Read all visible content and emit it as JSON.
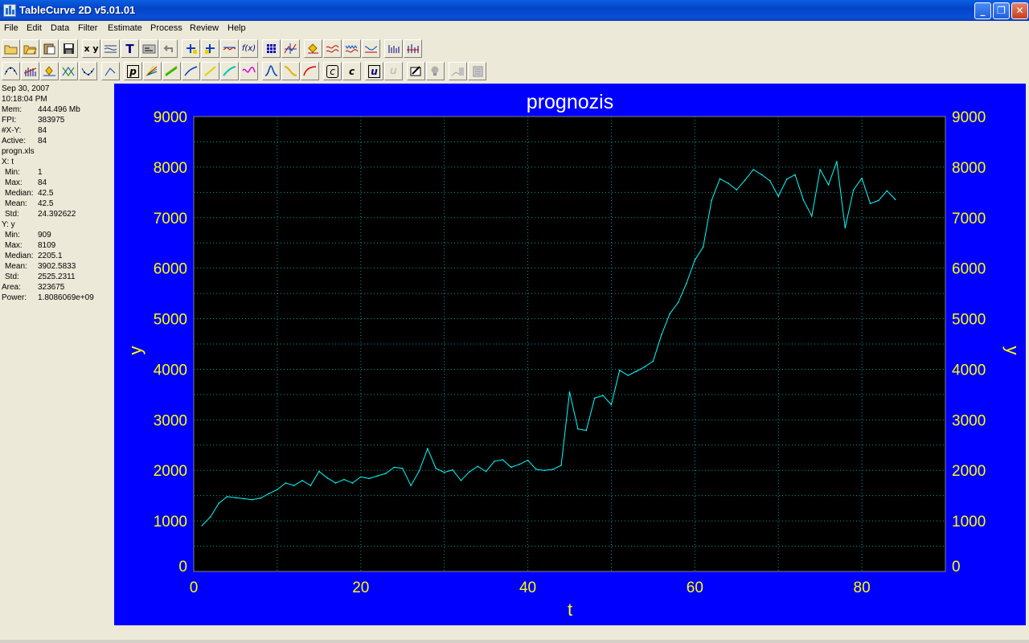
{
  "window": {
    "title": "TableCurve 2D v5.01.01"
  },
  "menu": [
    "File",
    "Edit",
    "Data",
    "Filter",
    "Estimate",
    "Process",
    "Review",
    "Help"
  ],
  "stats": {
    "date": "Sep 30, 2007",
    "time": "10:18:04 PM",
    "general": [
      {
        "key": "Mem:",
        "value": "444.496 Mb"
      },
      {
        "key": "FPI:",
        "value": "383975"
      },
      {
        "key": "#X-Y:",
        "value": "84"
      },
      {
        "key": "Active:",
        "value": "84"
      }
    ],
    "file": "progn.xls",
    "x_header": "X: t",
    "x_stats": [
      {
        "key": "Min:",
        "value": "1"
      },
      {
        "key": "Max:",
        "value": "84"
      },
      {
        "key": "Median:",
        "value": "42.5"
      },
      {
        "key": "Mean:",
        "value": "42.5"
      },
      {
        "key": "Std:",
        "value": "24.392622"
      }
    ],
    "y_header": "Y: y",
    "y_stats": [
      {
        "key": "Min:",
        "value": "909"
      },
      {
        "key": "Max:",
        "value": "8109"
      },
      {
        "key": "Median:",
        "value": "2205.1"
      },
      {
        "key": "Mean:",
        "value": "3902.5833"
      },
      {
        "key": "Std:",
        "value": "2525.2311"
      }
    ],
    "extra": [
      {
        "key": "Area:",
        "value": "323675"
      },
      {
        "key": "Power:",
        "value": "1.8086069e+09"
      }
    ]
  },
  "colors": {
    "panel_bg": "#0000ff",
    "plot_bg": "#000000",
    "axis_text": "#ffff00",
    "title_text": "#ffffff",
    "series": "#00ffff",
    "grid": "#00a0a0"
  },
  "chart_data": {
    "type": "line",
    "title": "prognozis",
    "xlabel": "t",
    "ylabel": "y",
    "xlim": [
      0,
      90
    ],
    "ylim": [
      0,
      9000
    ],
    "xticks": [
      0,
      20,
      40,
      60,
      80
    ],
    "yticks": [
      0,
      1000,
      2000,
      3000,
      4000,
      5000,
      6000,
      7000,
      8000,
      9000
    ],
    "grid": true,
    "x": [
      1,
      2,
      3,
      4,
      5,
      6,
      7,
      8,
      9,
      10,
      11,
      12,
      13,
      14,
      15,
      16,
      17,
      18,
      19,
      20,
      21,
      22,
      23,
      24,
      25,
      26,
      27,
      28,
      29,
      30,
      31,
      32,
      33,
      34,
      35,
      36,
      37,
      38,
      39,
      40,
      41,
      42,
      43,
      44,
      45,
      46,
      47,
      48,
      49,
      50,
      51,
      52,
      53,
      54,
      55,
      56,
      57,
      58,
      59,
      60,
      61,
      62,
      63,
      64,
      65,
      66,
      67,
      68,
      69,
      70,
      71,
      72,
      73,
      74,
      75,
      76,
      77,
      78,
      79,
      80,
      81,
      82,
      83,
      84
    ],
    "y": [
      909,
      1080,
      1350,
      1480,
      1460,
      1440,
      1420,
      1450,
      1540,
      1620,
      1750,
      1700,
      1800,
      1700,
      1980,
      1850,
      1750,
      1820,
      1750,
      1870,
      1840,
      1890,
      1940,
      2060,
      2040,
      1700,
      1990,
      2430,
      2040,
      1960,
      2010,
      1800,
      1970,
      2080,
      1980,
      2180,
      2210,
      2060,
      2120,
      2200,
      2020,
      2000,
      2020,
      2100,
      3550,
      2820,
      2790,
      3430,
      3480,
      3300,
      3980,
      3880,
      3960,
      4050,
      4160,
      4680,
      5100,
      5320,
      5700,
      6160,
      6420,
      7340,
      7770,
      7680,
      7550,
      7740,
      7950,
      7850,
      7730,
      7420,
      7760,
      7850,
      7350,
      7030,
      7950,
      7650,
      8109,
      6800,
      7550,
      7780,
      7280,
      7340,
      7530,
      7360
    ]
  }
}
